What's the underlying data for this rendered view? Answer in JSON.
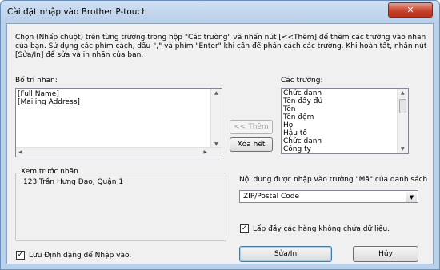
{
  "window": {
    "title": "Cài đặt nhập vào Brother P-touch",
    "close_glyph": "✕"
  },
  "instructions": "Chọn (Nhấp chuột) trên từng trường trong hộp \"Các trường\" và nhấn nút [<<Thêm] để thêm các trường vào nhãn của bạn. Sử dụng các phím cách, dấu \",\" và phím \"Enter\" khi cần để phân cách các trường. Khi hoàn tất, nhấn nút [Sửa/In] để sửa và in nhãn của bạn.",
  "layout_panel": {
    "label": "Bố trí nhãn:",
    "lines": [
      "[Full Name]",
      "[Mailing Address]"
    ]
  },
  "fields_panel": {
    "label": "Các trường:",
    "items": [
      "Chức danh",
      "Tên đầy đủ",
      "Tên",
      "Tên đệm",
      "Họ",
      "Hậu tố",
      "Chức danh",
      "Công ty"
    ]
  },
  "buttons": {
    "add": "<< Thêm",
    "clear_all": "Xóa hết",
    "edit_print": "Sửa/In",
    "cancel": "Hủy"
  },
  "preview": {
    "caption": "Xem trước nhãn",
    "text": "123 Trần Hưng Đạo, Quận 1"
  },
  "code_field": {
    "label": "Nội dung được nhập vào trường \"Mã\" của danh sách",
    "selected": "ZIP/Postal Code"
  },
  "checkboxes": {
    "fill_empty_rows": {
      "label": "Lấp đầy các hàng không chứa dữ liệu.",
      "checked": true
    },
    "save_format": {
      "label": "Lưu Định dạng để Nhập vào.",
      "checked": true
    }
  },
  "icons": {
    "close": "close-icon",
    "dropdown": "chevron-down-icon",
    "check": "checkmark-icon"
  }
}
